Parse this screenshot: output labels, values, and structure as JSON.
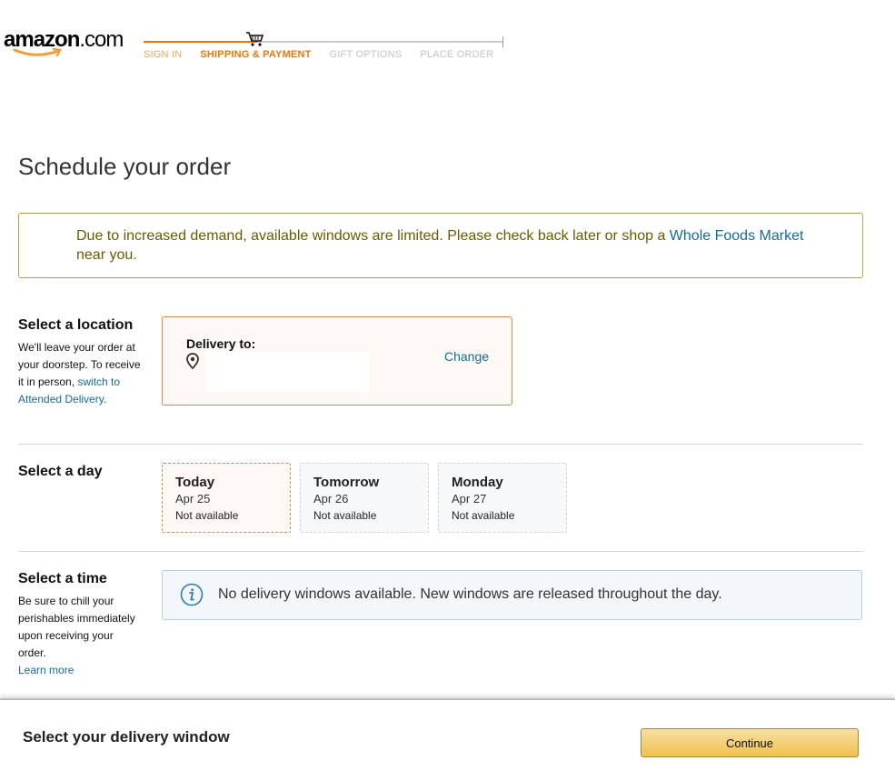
{
  "header": {
    "logo_main": "amazon",
    "logo_suffix": ".com",
    "steps": [
      {
        "label": "SIGN IN",
        "state": "done"
      },
      {
        "label": "SHIPPING & PAYMENT",
        "state": "active"
      },
      {
        "label": "GIFT OPTIONS",
        "state": "todo"
      },
      {
        "label": "PLACE ORDER",
        "state": "todo"
      }
    ]
  },
  "page_title": "Schedule your order",
  "alert": {
    "text_before": "Due to increased demand, available windows are limited. Please check back later or shop a ",
    "link": "Whole Foods Market",
    "text_after": " near you."
  },
  "location": {
    "heading": "Select a location",
    "desc": "We'll leave your order at your doorstep. To receive it in person, ",
    "link": "switch to Attended Delivery.",
    "card_title": "Delivery to:",
    "change": "Change"
  },
  "day": {
    "heading": "Select a day",
    "days": [
      {
        "name": "Today",
        "date": "Apr 25",
        "status": "Not available"
      },
      {
        "name": "Tomorrow",
        "date": "Apr 26",
        "status": "Not available"
      },
      {
        "name": "Monday",
        "date": "Apr 27",
        "status": "Not available"
      }
    ]
  },
  "time": {
    "heading": "Select a time",
    "desc": "Be sure to chill your perishables immediately upon receiving your order.",
    "link": "Learn more",
    "info": "No delivery windows available. New windows are released throughout the day."
  },
  "footer": {
    "title": "Select your delivery window",
    "continue": "Continue"
  },
  "colors": {
    "accent_orange": "#e47911",
    "link_blue": "#136c9c",
    "alert_border": "#b8a04a",
    "button_yellow": "#f0c14b"
  }
}
